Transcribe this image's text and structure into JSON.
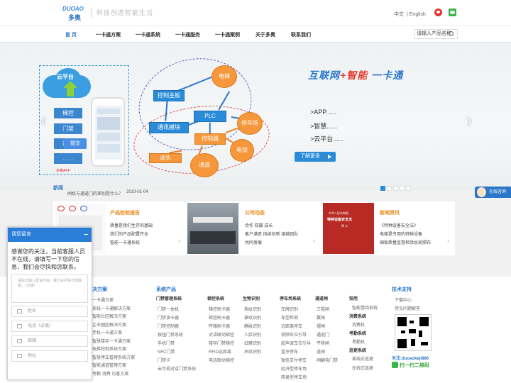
{
  "header": {
    "logo_en": "DUOAO",
    "logo_cn": "多奥",
    "slogan": "科技创造智能生活",
    "lang_cn": "中文",
    "lang_en": "English",
    "icons": [
      "weibo-icon",
      "wechat-icon"
    ]
  },
  "nav": {
    "items": [
      "首 页",
      "一卡通方案",
      "一卡通系统",
      "一卡通服务",
      "一卡通案例",
      "关于多奥",
      "联系我们"
    ],
    "search_placeholder": "请输入产品名称"
  },
  "banner": {
    "diagram": {
      "cloud": "云平台",
      "side_buttons": [
        "梯控",
        "门禁",
        "通道",
        "……"
      ],
      "app_label": "多奥APP",
      "nodes": {
        "control_board": "控制主板",
        "comm_module": "通讯模块",
        "plc": "PLC",
        "elevator": "电梯",
        "parking": "停车场",
        "controller": "控制器",
        "lock": "电锁",
        "reader": "读头",
        "passage": "通道"
      }
    },
    "headline_a": "互联网",
    "headline_plus": "+",
    "headline_b": "智能",
    "headline_c": "一卡通",
    "features": [
      ">APP......",
      ">智慧......",
      ">云平台......"
    ],
    "learn_more": "了解更多"
  },
  "news": {
    "label": "新闻",
    "item": "闸机与通道门的差别是什么？",
    "date": "2019-01-04"
  },
  "consult": "在线咨询",
  "cards": [
    {
      "title": "产品检验报告",
      "lines": [
        "质量是我们生存的基础",
        "我们的产品配置齐全",
        "智能一卡通系统"
      ]
    },
    {
      "title": "公司动态",
      "lines": [
        "合作 双赢 成长",
        "客户满意 持续创新 熔铸团队",
        "共同发展"
      ]
    },
    {
      "title": "新闻资讯",
      "lines": [
        "《特种设备安全法》",
        "电梯是专用的特种设备",
        "国家质量监督检验总局颁布"
      ]
    }
  ],
  "certificate": {
    "line1": "中华人民共和国",
    "line2": "特种设备安全法",
    "line3": "释 义"
  },
  "chat": {
    "title": "请您留言",
    "message": "感谢您的关注，当前客服人员不在线，请填写一下您的信息，我们会尽快和您联系。",
    "textarea_placeholder": "请在此输入留言内容，我们会尽快与您联系。（必填）",
    "fields": [
      "姓名",
      "电话（必填）",
      "邮箱",
      "地址"
    ],
    "submit": "提交"
  },
  "footer": {
    "col1_title": "决方案",
    "col1_links": [
      "一卡通方案",
      "系统一卡通解决方案",
      "智能社区解决方案",
      "企业园区解决方案",
      "手机一卡通方案",
      "智慧楼宇一卡通方案",
      "电梯控制系统方案",
      "智慧停车管理系统方案",
      "智能通道管理方案",
      "考勤 消费 访客方案"
    ],
    "col2_title": "系统产品",
    "col2_sub": "门禁管理系统",
    "col2_links": [
      "门禁一体机",
      "门禁读卡器",
      "门禁控制器",
      "按钮门禁系统",
      "手机门禁",
      "NFC门禁",
      "门禁卡",
      "云可视对讲门禁系统"
    ],
    "col3_title": "梯控系统",
    "col3_links": [
      "梯控刷卡器",
      "梯控刷卡器",
      "呼梯刷卡器",
      "对讲联动梯控",
      "楼宇门禁梯控",
      "RFID远距离",
      "电话联动梯控"
    ],
    "col4_title": "生物识别",
    "col4_links": [
      "指纹识别",
      "掌纹识别",
      "静脉识别",
      "人脸识别",
      "虹膜识别",
      "声纹识别"
    ],
    "col5_title": "停车场系统",
    "col5_links": [
      "车牌识别",
      "车型检测",
      "远距离停车",
      "视频车位引导",
      "超声波车位引导",
      "蓝牙停车",
      "微信支付停车",
      "经济型停车场",
      "简易型停车场"
    ],
    "col6_title": "通道闸",
    "col6_links": [
      "三辊闸",
      "翼闸",
      "摆闸",
      "通道门",
      "平移闸",
      "道闸",
      "闸翻电门禁"
    ],
    "col7_title": "馆用",
    "col7_sub_a": "消费系统",
    "col7_sub_b": "考勤系统",
    "col7_sub_c": "巡更系统",
    "col7_links": [
      "智能借阅系统",
      "消费机",
      "考勤机",
      "离线式巡更",
      "在线式巡更"
    ],
    "col8_title": "技术支持",
    "col8_links": [
      "下载中心",
      "常见问题解答"
    ],
    "follow": "关注:duoaokeji886",
    "scan": "扫一扫二维码"
  }
}
